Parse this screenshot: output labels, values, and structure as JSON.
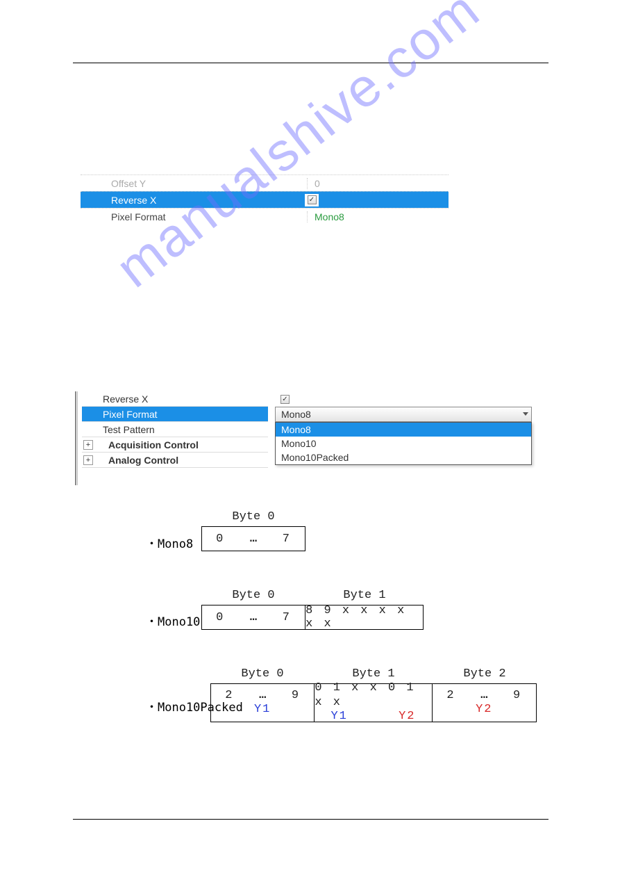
{
  "watermark": "manualshive.com",
  "table1": {
    "rows": [
      {
        "label": "Offset Y",
        "value": "0"
      },
      {
        "label": "Reverse X",
        "checked": true
      },
      {
        "label": "Pixel Format",
        "value": "Mono8"
      }
    ]
  },
  "table2": {
    "rows": [
      {
        "label": "Reverse X"
      },
      {
        "label": "Pixel Format"
      },
      {
        "label": "Test Pattern"
      },
      {
        "label": "Acquisition Control"
      },
      {
        "label": "Analog Control"
      }
    ],
    "dropdown_value": "Mono8",
    "dropdown_items": [
      "Mono8",
      "Mono10",
      "Mono10Packed"
    ]
  },
  "diagrams": {
    "mono8": {
      "bullet": "・Mono8",
      "headers": [
        "Byte 0"
      ],
      "cells": [
        "0    …    7"
      ]
    },
    "mono10": {
      "bullet": "・Mono10",
      "headers": [
        "Byte 0",
        "Byte 1"
      ],
      "cells": [
        "0    …    7",
        "8 9 x x x x x x"
      ]
    },
    "mono10packed": {
      "bullet": "・Mono10Packed",
      "headers": [
        "Byte 0",
        "Byte 1",
        "Byte 2"
      ],
      "row1": [
        "2    …    9",
        "0 1 x x 0 1 x x",
        "2    …    9"
      ],
      "row2_b0": "Y1",
      "row2_b1a": "Y1",
      "row2_b1b": "Y2",
      "row2_b2": "Y2"
    }
  }
}
